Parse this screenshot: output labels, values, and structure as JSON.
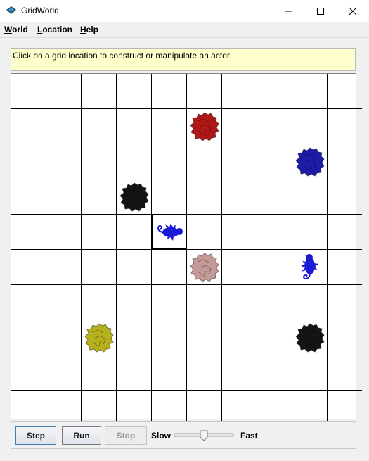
{
  "window": {
    "title": "GridWorld",
    "app_icon": "gridworld-diamond-icon",
    "minimize_icon": "minimize-icon",
    "maximize_icon": "maximize-icon",
    "close_icon": "close-icon"
  },
  "menubar": {
    "items": [
      {
        "label": "World",
        "mnemonic": "W",
        "rest": "orld"
      },
      {
        "label": "Location",
        "mnemonic": "L",
        "rest": "ocation"
      },
      {
        "label": "Help",
        "mnemonic": "H",
        "rest": "elp"
      }
    ]
  },
  "message": "Click on a grid location to construct or manipulate an actor.",
  "grid": {
    "rows": 10,
    "cols": 10,
    "selected": {
      "row": 4,
      "col": 4
    },
    "actors": [
      {
        "type": "rock",
        "row": 1,
        "col": 5,
        "color": "#b01818"
      },
      {
        "type": "rock",
        "row": 2,
        "col": 8,
        "color": "#1c1ca8"
      },
      {
        "type": "rock",
        "row": 3,
        "col": 3,
        "color": "#141414"
      },
      {
        "type": "bug",
        "row": 4,
        "col": 4,
        "color": "#1a1ad6",
        "facing": "right"
      },
      {
        "type": "rock",
        "row": 5,
        "col": 5,
        "color": "#c49a96"
      },
      {
        "type": "bug",
        "row": 5,
        "col": 8,
        "color": "#1a1ad6",
        "facing": "up"
      },
      {
        "type": "rock",
        "row": 7,
        "col": 2,
        "color": "#b5b01c"
      },
      {
        "type": "rock",
        "row": 7,
        "col": 8,
        "color": "#141414"
      }
    ]
  },
  "controls": {
    "step_label": "Step",
    "run_label": "Run",
    "stop_label": "Stop",
    "slow_label": "Slow",
    "fast_label": "Fast",
    "speed_fraction": 0.5
  }
}
